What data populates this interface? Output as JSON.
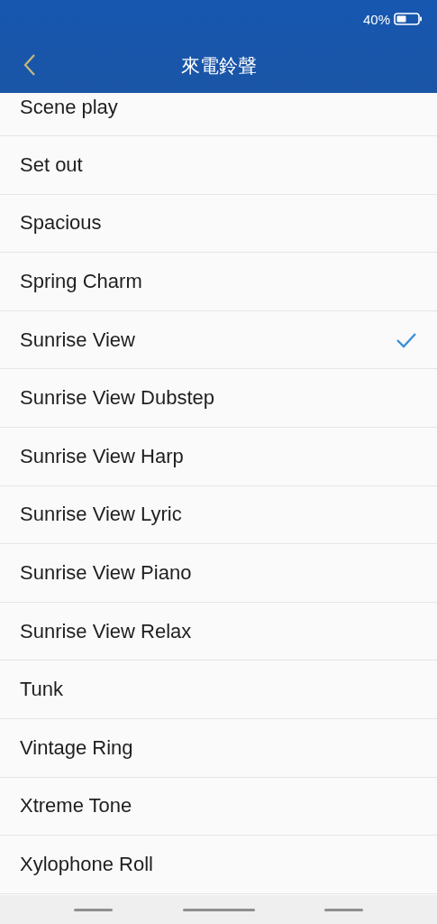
{
  "status_bar": {
    "battery_text": "40%"
  },
  "header": {
    "title": "來電鈴聲"
  },
  "ringtones": [
    {
      "name": "Scene play",
      "selected": false
    },
    {
      "name": "Set out",
      "selected": false
    },
    {
      "name": "Spacious",
      "selected": false
    },
    {
      "name": "Spring Charm",
      "selected": false
    },
    {
      "name": "Sunrise View",
      "selected": true
    },
    {
      "name": "Sunrise View Dubstep",
      "selected": false
    },
    {
      "name": "Sunrise View Harp",
      "selected": false
    },
    {
      "name": "Sunrise View Lyric",
      "selected": false
    },
    {
      "name": "Sunrise View Piano",
      "selected": false
    },
    {
      "name": "Sunrise View Relax",
      "selected": false
    },
    {
      "name": "Tunk",
      "selected": false
    },
    {
      "name": "Vintage Ring",
      "selected": false
    },
    {
      "name": "Xtreme Tone",
      "selected": false
    },
    {
      "name": "Xylophone Roll",
      "selected": false
    }
  ]
}
